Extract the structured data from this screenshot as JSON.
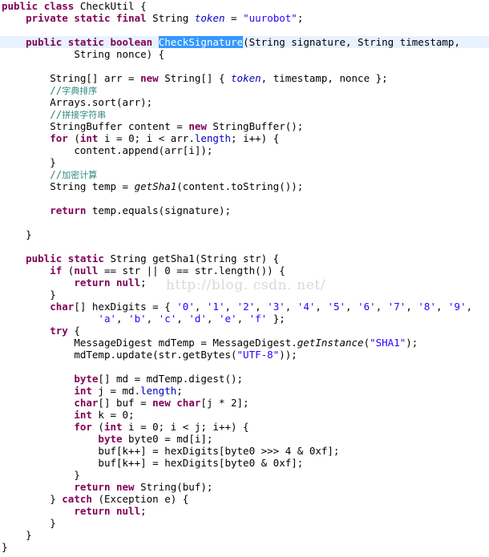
{
  "editor": {
    "language": "java",
    "file_class_name": "CheckUtil",
    "theme": "eclipse-light",
    "colors": {
      "background": "#ffffff",
      "keyword": "#7f0055",
      "string": "#2a00ff",
      "field": "#0000c0",
      "comment": "#3f7f5f",
      "cjk_comment": "#2e8b83",
      "selection_background": "#3399ff",
      "selection_foreground": "#ffffff",
      "current_line_highlight": "#e8f2fe",
      "watermark": "#d9d9d9",
      "foreground": "#000000"
    },
    "selection": {
      "text": "CheckSignature",
      "line_number": 4
    },
    "watermark": "http://blog. csdn. net/"
  },
  "code": {
    "lines": [
      {
        "n": 1,
        "indent": 0,
        "highlight": false,
        "tokens": [
          {
            "t": "kw",
            "v": "public"
          },
          {
            "t": "p",
            "v": " "
          },
          {
            "t": "kw",
            "v": "class"
          },
          {
            "t": "p",
            "v": " CheckUtil {"
          }
        ]
      },
      {
        "n": 2,
        "indent": 1,
        "highlight": false,
        "tokens": [
          {
            "t": "kw",
            "v": "private"
          },
          {
            "t": "p",
            "v": " "
          },
          {
            "t": "kw",
            "v": "static"
          },
          {
            "t": "p",
            "v": " "
          },
          {
            "t": "kw",
            "v": "final"
          },
          {
            "t": "p",
            "v": " String "
          },
          {
            "t": "fld",
            "v": "token"
          },
          {
            "t": "p",
            "v": " = "
          },
          {
            "t": "str",
            "v": "\"uurobot\""
          },
          {
            "t": "p",
            "v": ";"
          }
        ]
      },
      {
        "n": 3,
        "indent": 0,
        "highlight": false,
        "tokens": []
      },
      {
        "n": 4,
        "indent": 1,
        "highlight": true,
        "tokens": [
          {
            "t": "kw",
            "v": "public"
          },
          {
            "t": "p",
            "v": " "
          },
          {
            "t": "kw",
            "v": "static"
          },
          {
            "t": "p",
            "v": " "
          },
          {
            "t": "kw",
            "v": "boolean"
          },
          {
            "t": "p",
            "v": " "
          },
          {
            "t": "sel",
            "v": "CheckSignature"
          },
          {
            "t": "p",
            "v": "(String signature, String timestamp,"
          }
        ]
      },
      {
        "n": 5,
        "indent": 3,
        "highlight": false,
        "tokens": [
          {
            "t": "p",
            "v": "String nonce) {"
          }
        ]
      },
      {
        "n": 6,
        "indent": 0,
        "highlight": false,
        "tokens": []
      },
      {
        "n": 7,
        "indent": 2,
        "highlight": false,
        "tokens": [
          {
            "t": "p",
            "v": "String[] arr = "
          },
          {
            "t": "kw",
            "v": "new"
          },
          {
            "t": "p",
            "v": " String[] { "
          },
          {
            "t": "fld",
            "v": "token"
          },
          {
            "t": "p",
            "v": ", timestamp, nonce };"
          }
        ]
      },
      {
        "n": 8,
        "indent": 2,
        "highlight": false,
        "tokens": [
          {
            "t": "cmt",
            "v": "//"
          },
          {
            "t": "cjk",
            "v": "字典排序"
          }
        ]
      },
      {
        "n": 9,
        "indent": 2,
        "highlight": false,
        "tokens": [
          {
            "t": "p",
            "v": "Arrays.sort(arr);"
          }
        ]
      },
      {
        "n": 10,
        "indent": 2,
        "highlight": false,
        "tokens": [
          {
            "t": "cmt",
            "v": "//"
          },
          {
            "t": "cjk",
            "v": "拼接字符串"
          }
        ]
      },
      {
        "n": 11,
        "indent": 2,
        "highlight": false,
        "tokens": [
          {
            "t": "p",
            "v": "StringBuffer content = "
          },
          {
            "t": "kw",
            "v": "new"
          },
          {
            "t": "p",
            "v": " StringBuffer();"
          }
        ]
      },
      {
        "n": 12,
        "indent": 2,
        "highlight": false,
        "tokens": [
          {
            "t": "kw",
            "v": "for"
          },
          {
            "t": "p",
            "v": " ("
          },
          {
            "t": "kw",
            "v": "int"
          },
          {
            "t": "p",
            "v": " i = 0; i < arr."
          },
          {
            "t": "fldn",
            "v": "length"
          },
          {
            "t": "p",
            "v": "; i++) {"
          }
        ]
      },
      {
        "n": 13,
        "indent": 3,
        "highlight": false,
        "tokens": [
          {
            "t": "p",
            "v": "content.append(arr[i]);"
          }
        ]
      },
      {
        "n": 14,
        "indent": 2,
        "highlight": false,
        "tokens": [
          {
            "t": "p",
            "v": "}"
          }
        ]
      },
      {
        "n": 15,
        "indent": 2,
        "highlight": false,
        "tokens": [
          {
            "t": "cmt",
            "v": "//"
          },
          {
            "t": "cjk",
            "v": "加密计算"
          }
        ]
      },
      {
        "n": 16,
        "indent": 2,
        "highlight": false,
        "tokens": [
          {
            "t": "p",
            "v": "String temp = "
          },
          {
            "t": "mth",
            "v": "getSha1"
          },
          {
            "t": "p",
            "v": "(content.toString());"
          }
        ]
      },
      {
        "n": 17,
        "indent": 0,
        "highlight": false,
        "tokens": []
      },
      {
        "n": 18,
        "indent": 2,
        "highlight": false,
        "tokens": [
          {
            "t": "kw",
            "v": "return"
          },
          {
            "t": "p",
            "v": " temp.equals(signature);"
          }
        ]
      },
      {
        "n": 19,
        "indent": 0,
        "highlight": false,
        "tokens": []
      },
      {
        "n": 20,
        "indent": 1,
        "highlight": false,
        "tokens": [
          {
            "t": "p",
            "v": "}"
          }
        ]
      },
      {
        "n": 21,
        "indent": 0,
        "highlight": false,
        "tokens": []
      },
      {
        "n": 22,
        "indent": 1,
        "highlight": false,
        "tokens": [
          {
            "t": "kw",
            "v": "public"
          },
          {
            "t": "p",
            "v": " "
          },
          {
            "t": "kw",
            "v": "static"
          },
          {
            "t": "p",
            "v": " String getSha1(String str) {"
          }
        ]
      },
      {
        "n": 23,
        "indent": 2,
        "highlight": false,
        "tokens": [
          {
            "t": "kw",
            "v": "if"
          },
          {
            "t": "p",
            "v": " ("
          },
          {
            "t": "kw",
            "v": "null"
          },
          {
            "t": "p",
            "v": " == str || 0 == str.length()) {"
          }
        ]
      },
      {
        "n": 24,
        "indent": 3,
        "highlight": false,
        "tokens": [
          {
            "t": "kw",
            "v": "return"
          },
          {
            "t": "p",
            "v": " "
          },
          {
            "t": "kw",
            "v": "null"
          },
          {
            "t": "p",
            "v": ";"
          }
        ]
      },
      {
        "n": 25,
        "indent": 2,
        "highlight": false,
        "tokens": [
          {
            "t": "p",
            "v": "}"
          }
        ]
      },
      {
        "n": 26,
        "indent": 2,
        "highlight": false,
        "tokens": [
          {
            "t": "kw",
            "v": "char"
          },
          {
            "t": "p",
            "v": "[] hexDigits = { "
          },
          {
            "t": "str",
            "v": "'0'"
          },
          {
            "t": "p",
            "v": ", "
          },
          {
            "t": "str",
            "v": "'1'"
          },
          {
            "t": "p",
            "v": ", "
          },
          {
            "t": "str",
            "v": "'2'"
          },
          {
            "t": "p",
            "v": ", "
          },
          {
            "t": "str",
            "v": "'3'"
          },
          {
            "t": "p",
            "v": ", "
          },
          {
            "t": "str",
            "v": "'4'"
          },
          {
            "t": "p",
            "v": ", "
          },
          {
            "t": "str",
            "v": "'5'"
          },
          {
            "t": "p",
            "v": ", "
          },
          {
            "t": "str",
            "v": "'6'"
          },
          {
            "t": "p",
            "v": ", "
          },
          {
            "t": "str",
            "v": "'7'"
          },
          {
            "t": "p",
            "v": ", "
          },
          {
            "t": "str",
            "v": "'8'"
          },
          {
            "t": "p",
            "v": ", "
          },
          {
            "t": "str",
            "v": "'9'"
          },
          {
            "t": "p",
            "v": ","
          }
        ]
      },
      {
        "n": 27,
        "indent": 4,
        "highlight": false,
        "tokens": [
          {
            "t": "str",
            "v": "'a'"
          },
          {
            "t": "p",
            "v": ", "
          },
          {
            "t": "str",
            "v": "'b'"
          },
          {
            "t": "p",
            "v": ", "
          },
          {
            "t": "str",
            "v": "'c'"
          },
          {
            "t": "p",
            "v": ", "
          },
          {
            "t": "str",
            "v": "'d'"
          },
          {
            "t": "p",
            "v": ", "
          },
          {
            "t": "str",
            "v": "'e'"
          },
          {
            "t": "p",
            "v": ", "
          },
          {
            "t": "str",
            "v": "'f'"
          },
          {
            "t": "p",
            "v": " };"
          }
        ]
      },
      {
        "n": 28,
        "indent": 2,
        "highlight": false,
        "tokens": [
          {
            "t": "kw",
            "v": "try"
          },
          {
            "t": "p",
            "v": " {"
          }
        ]
      },
      {
        "n": 29,
        "indent": 3,
        "highlight": false,
        "tokens": [
          {
            "t": "p",
            "v": "MessageDigest mdTemp = MessageDigest."
          },
          {
            "t": "mth",
            "v": "getInstance"
          },
          {
            "t": "p",
            "v": "("
          },
          {
            "t": "str",
            "v": "\"SHA1\""
          },
          {
            "t": "p",
            "v": ");"
          }
        ]
      },
      {
        "n": 30,
        "indent": 3,
        "highlight": false,
        "tokens": [
          {
            "t": "p",
            "v": "mdTemp.update(str.getBytes("
          },
          {
            "t": "str",
            "v": "\"UTF-8\""
          },
          {
            "t": "p",
            "v": "));"
          }
        ]
      },
      {
        "n": 31,
        "indent": 0,
        "highlight": false,
        "tokens": []
      },
      {
        "n": 32,
        "indent": 3,
        "highlight": false,
        "tokens": [
          {
            "t": "kw",
            "v": "byte"
          },
          {
            "t": "p",
            "v": "[] md = mdTemp.digest();"
          }
        ]
      },
      {
        "n": 33,
        "indent": 3,
        "highlight": false,
        "tokens": [
          {
            "t": "kw",
            "v": "int"
          },
          {
            "t": "p",
            "v": " j = md."
          },
          {
            "t": "fldn",
            "v": "length"
          },
          {
            "t": "p",
            "v": ";"
          }
        ]
      },
      {
        "n": 34,
        "indent": 3,
        "highlight": false,
        "tokens": [
          {
            "t": "kw",
            "v": "char"
          },
          {
            "t": "p",
            "v": "[] buf = "
          },
          {
            "t": "kw",
            "v": "new"
          },
          {
            "t": "p",
            "v": " "
          },
          {
            "t": "kw",
            "v": "char"
          },
          {
            "t": "p",
            "v": "[j * 2];"
          }
        ]
      },
      {
        "n": 35,
        "indent": 3,
        "highlight": false,
        "tokens": [
          {
            "t": "kw",
            "v": "int"
          },
          {
            "t": "p",
            "v": " k = 0;"
          }
        ]
      },
      {
        "n": 36,
        "indent": 3,
        "highlight": false,
        "tokens": [
          {
            "t": "kw",
            "v": "for"
          },
          {
            "t": "p",
            "v": " ("
          },
          {
            "t": "kw",
            "v": "int"
          },
          {
            "t": "p",
            "v": " i = 0; i < j; i++) {"
          }
        ]
      },
      {
        "n": 37,
        "indent": 4,
        "highlight": false,
        "tokens": [
          {
            "t": "kw",
            "v": "byte"
          },
          {
            "t": "p",
            "v": " byte0 = md[i];"
          }
        ]
      },
      {
        "n": 38,
        "indent": 4,
        "highlight": false,
        "tokens": [
          {
            "t": "p",
            "v": "buf[k++] = hexDigits[byte0 >>> 4 & 0xf];"
          }
        ]
      },
      {
        "n": 39,
        "indent": 4,
        "highlight": false,
        "tokens": [
          {
            "t": "p",
            "v": "buf[k++] = hexDigits[byte0 & 0xf];"
          }
        ]
      },
      {
        "n": 40,
        "indent": 3,
        "highlight": false,
        "tokens": [
          {
            "t": "p",
            "v": "}"
          }
        ]
      },
      {
        "n": 41,
        "indent": 3,
        "highlight": false,
        "tokens": [
          {
            "t": "kw",
            "v": "return"
          },
          {
            "t": "p",
            "v": " "
          },
          {
            "t": "kw",
            "v": "new"
          },
          {
            "t": "p",
            "v": " String(buf);"
          }
        ]
      },
      {
        "n": 42,
        "indent": 2,
        "highlight": false,
        "tokens": [
          {
            "t": "p",
            "v": "} "
          },
          {
            "t": "kw",
            "v": "catch"
          },
          {
            "t": "p",
            "v": " (Exception e) {"
          }
        ]
      },
      {
        "n": 43,
        "indent": 3,
        "highlight": false,
        "tokens": [
          {
            "t": "kw",
            "v": "return"
          },
          {
            "t": "p",
            "v": " "
          },
          {
            "t": "kw",
            "v": "null"
          },
          {
            "t": "p",
            "v": ";"
          }
        ]
      },
      {
        "n": 44,
        "indent": 2,
        "highlight": false,
        "tokens": [
          {
            "t": "p",
            "v": "}"
          }
        ]
      },
      {
        "n": 45,
        "indent": 1,
        "highlight": false,
        "tokens": [
          {
            "t": "p",
            "v": "}"
          }
        ]
      },
      {
        "n": 46,
        "indent": 0,
        "highlight": false,
        "tokens": [
          {
            "t": "p",
            "v": "}"
          }
        ]
      }
    ]
  }
}
